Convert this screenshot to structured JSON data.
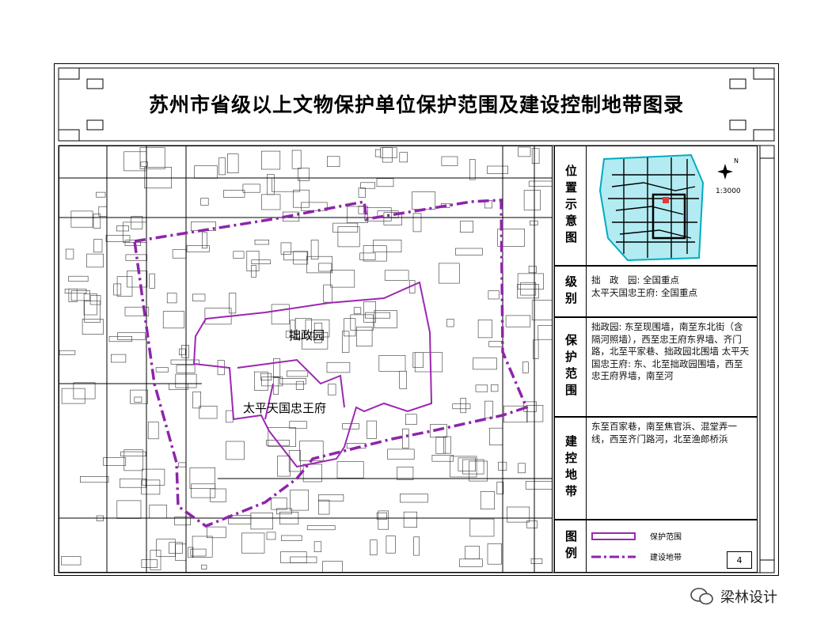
{
  "title": "苏州市省级以上文物保护单位保护范围及建设控制地带图录",
  "map": {
    "labels": {
      "garden": "拙政园",
      "mansion": "太平天国忠王府"
    }
  },
  "location": {
    "label": "位置示意图",
    "scale": "1:3000",
    "north": "N"
  },
  "level": {
    "label": "级别",
    "lines": [
      "拙　政　园: 全国重点",
      "太平天国忠王府: 全国重点"
    ]
  },
  "protection": {
    "label": "保护范围",
    "text": "拙政园: 东至现围墙，南至东北街（含隔河照墙），西至忠王府东界墙、齐门路，北至平家巷、拙政园北围墙 太平天国忠王府: 东、北至拙政园围墙，西至忠王府界墙，南至河"
  },
  "control": {
    "label": "建控地带",
    "text": "东至百家巷，南至焦官浜、混堂弄一线，西至齐门路河，北至渔郎桥浜"
  },
  "legend": {
    "label": "图例",
    "items": [
      "保护范围",
      "建设地带"
    ],
    "page": "4"
  },
  "watermark": "梁林设计",
  "colors": {
    "boundary": "#8e24aa",
    "protection": "#9c27b0",
    "cyan": "#00bcd4"
  }
}
